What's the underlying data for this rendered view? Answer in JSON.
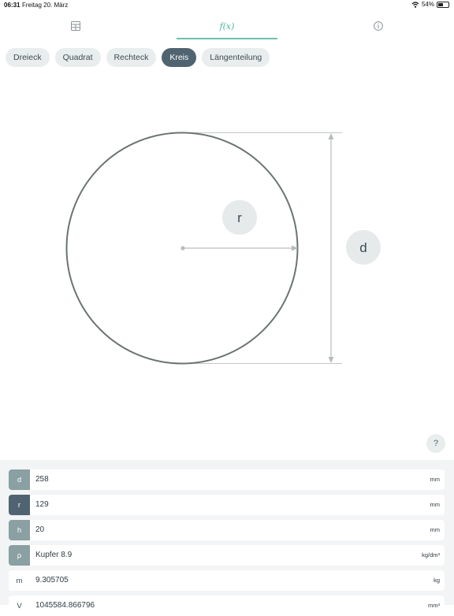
{
  "statusbar": {
    "time": "06:31",
    "date": "Freitag 20. März",
    "battery": "54%",
    "battery_level": 0.54
  },
  "toptabs": [
    {
      "icon": "table-icon"
    },
    {
      "label": "f(x)"
    },
    {
      "icon": "info-icon"
    }
  ],
  "shapes": [
    "Dreieck",
    "Quadrat",
    "Rechteck",
    "Kreis",
    "Längenteilung"
  ],
  "selected_shape": "Kreis",
  "diagram": {
    "radius_label": "r",
    "diameter_label": "d"
  },
  "help_label": "?",
  "fields": [
    {
      "symbol": "d",
      "value": "258",
      "unit": "mm"
    },
    {
      "symbol": "r",
      "value": "129",
      "unit": "mm"
    },
    {
      "symbol": "h",
      "value": "20",
      "unit": "mm"
    },
    {
      "symbol": "ρ",
      "value": "Kupfer 8.9",
      "unit": "kg/dm³"
    },
    {
      "symbol": "m",
      "value": "9.305705",
      "unit": "kg"
    },
    {
      "symbol": "V",
      "value": "1045584.866796",
      "unit": "mm³"
    }
  ],
  "colors": {
    "accent": "#6cc2a9",
    "pill_active": "#4f6470",
    "circle_stroke": "#6b7472",
    "dim_line": "#b6bcbd",
    "symbol_input": "#8aa0a2",
    "symbol_active": "#4f6470"
  }
}
